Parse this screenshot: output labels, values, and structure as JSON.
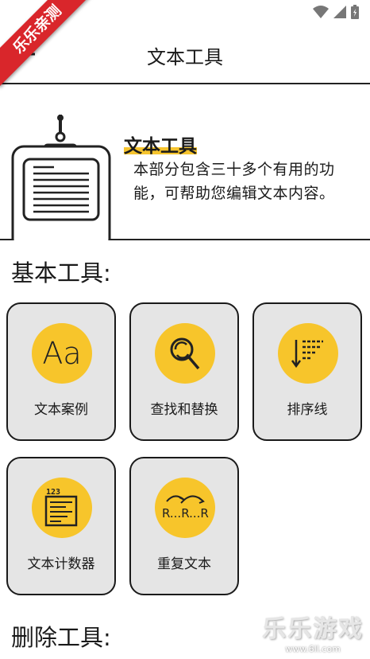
{
  "ribbon": {
    "text": "乐乐亲测"
  },
  "status_bar": {
    "icons": [
      "wifi-icon",
      "signal-icon",
      "battery-icon"
    ]
  },
  "app_bar": {
    "title": "文本工具",
    "back_icon": "arrow-back-icon"
  },
  "hero": {
    "title": "文本工具",
    "description": "本部分包含三十多个有用的功能，可帮助您编辑文本内容。"
  },
  "sections": [
    {
      "title": "基本工具:",
      "items": [
        {
          "label": "文本案例",
          "icon": "font-aa-icon",
          "icon_text": "Aa"
        },
        {
          "label": "查找和替换",
          "icon": "magnifier-icon"
        },
        {
          "label": "排序线",
          "icon": "sort-lines-icon"
        },
        {
          "label": "文本计数器",
          "icon": "text-counter-icon",
          "icon_text": "123"
        },
        {
          "label": "重复文本",
          "icon": "repeat-text-icon",
          "icon_text": "R...R...R"
        }
      ]
    },
    {
      "title": "删除工具:"
    }
  ],
  "watermark": {
    "text": "乐乐游戏",
    "sub": "www.6ll.com"
  },
  "colors": {
    "accent": "#f7c52b",
    "card_bg": "#e5e5e5",
    "ribbon": "#d9262b",
    "border": "#1a1a1a"
  }
}
